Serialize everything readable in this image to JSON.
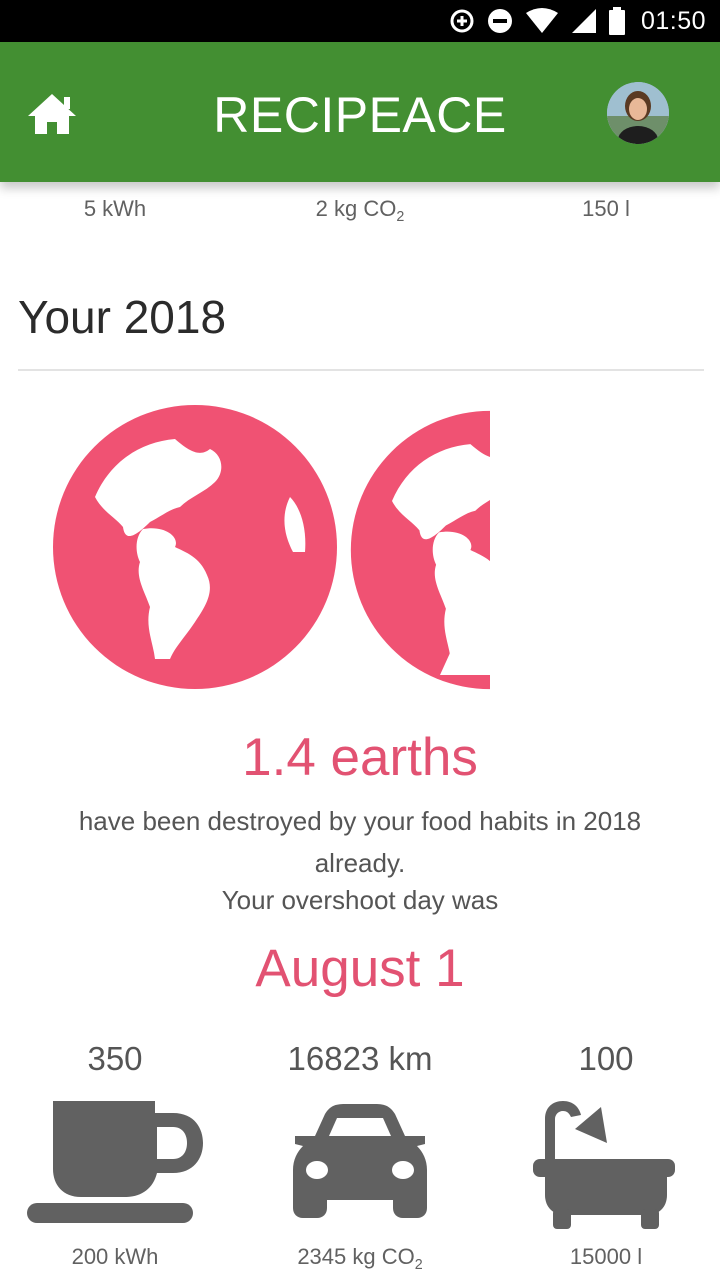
{
  "status_bar": {
    "time": "01:50"
  },
  "app_bar": {
    "title": "RECIPEACE"
  },
  "previous_stats": {
    "energy": "5 kWh",
    "co2_prefix": "2 kg CO",
    "co2_sub": "2",
    "water": "150 l"
  },
  "section": {
    "title": "Your 2018"
  },
  "earths": {
    "headline": "1.4 earths",
    "description": "have been destroyed by your food habits in 2018 already.",
    "overshoot_label": "Your overshoot day was",
    "overshoot_date": "August 1",
    "globe_color": "#f05273"
  },
  "stats": [
    {
      "value": "350",
      "icon": "coffee-cup-icon",
      "sub": "200 kWh"
    },
    {
      "value": "16823 km",
      "icon": "car-icon",
      "sub_prefix": "2345 kg CO",
      "sub_sub": "2"
    },
    {
      "value": "100",
      "icon": "bathtub-icon",
      "sub": "15000 l"
    }
  ],
  "colors": {
    "appbar": "#438f32",
    "accent": "#e25272",
    "icon_gray": "#616161"
  }
}
